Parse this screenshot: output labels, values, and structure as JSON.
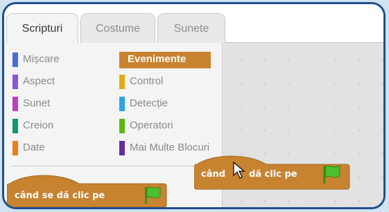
{
  "tabs": [
    {
      "label": "Scripturi",
      "active": true
    },
    {
      "label": "Costume",
      "active": false
    },
    {
      "label": "Sunete",
      "active": false
    }
  ],
  "categories": [
    {
      "label": "Mișcare",
      "color": "#4a6cd4",
      "active": false
    },
    {
      "label": "Aspect",
      "color": "#8a55d7",
      "active": false
    },
    {
      "label": "Sunet",
      "color": "#bb42c3",
      "active": false
    },
    {
      "label": "Creion",
      "color": "#0e9a6c",
      "active": false
    },
    {
      "label": "Date",
      "color": "#ee7d16",
      "active": false
    },
    {
      "label": "Evenimente",
      "color": "#c88330",
      "active": true
    },
    {
      "label": "Control",
      "color": "#e1a91a",
      "active": false
    },
    {
      "label": "Detecție",
      "color": "#2ca5e2",
      "active": false
    },
    {
      "label": "Operatori",
      "color": "#5cb712",
      "active": false
    },
    {
      "label": "Mai Multe Blocuri",
      "color": "#632d99",
      "active": false
    }
  ],
  "palette_block": {
    "text": "când se dă clic pe",
    "icon": "green-flag-icon"
  },
  "script_block": {
    "text_before": "când",
    "text_after": "dă clic pe",
    "icon": "green-flag-icon"
  },
  "colors": {
    "event_block": "#c88330",
    "frame_border": "#1f4e8c",
    "flag": "#4cbf2f"
  }
}
